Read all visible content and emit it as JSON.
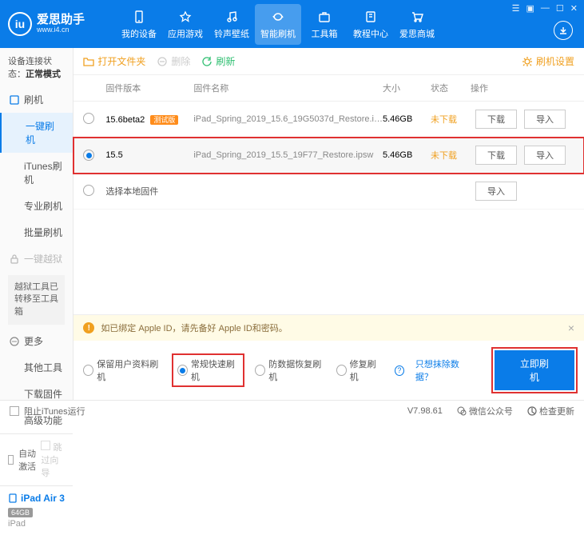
{
  "app": {
    "name_cn": "爱思助手",
    "name_en": "www.i4.cn"
  },
  "nav": [
    {
      "label": "我的设备"
    },
    {
      "label": "应用游戏"
    },
    {
      "label": "铃声壁纸"
    },
    {
      "label": "智能刷机",
      "active": true
    },
    {
      "label": "工具箱"
    },
    {
      "label": "教程中心"
    },
    {
      "label": "爱思商城"
    }
  ],
  "connection": {
    "prefix": "设备连接状态：",
    "value": "正常模式"
  },
  "sidebar": {
    "group_flash": "刷机",
    "items_flash": [
      {
        "label": "一键刷机",
        "active": true
      },
      {
        "label": "iTunes刷机"
      },
      {
        "label": "专业刷机"
      },
      {
        "label": "批量刷机"
      }
    ],
    "group_jb": "一键越狱",
    "jb_msg": "越狱工具已转移至工具箱",
    "group_more": "更多",
    "items_more": [
      {
        "label": "其他工具"
      },
      {
        "label": "下载固件"
      },
      {
        "label": "高级功能"
      }
    ],
    "auto_activate": "自动激活",
    "skip_guide": "跳过向导",
    "device": {
      "name": "iPad Air 3",
      "storage": "64GB",
      "type": "iPad"
    }
  },
  "toolbar": {
    "open_folder": "打开文件夹",
    "delete": "删除",
    "refresh": "刷新",
    "settings": "刷机设置"
  },
  "table": {
    "headers": {
      "version": "固件版本",
      "name": "固件名称",
      "size": "大小",
      "status": "状态",
      "ops": "操作"
    },
    "rows": [
      {
        "version": "15.6beta2",
        "beta": "测试版",
        "name": "iPad_Spring_2019_15.6_19G5037d_Restore.i…",
        "size": "5.46GB",
        "status": "未下载",
        "selected": false
      },
      {
        "version": "15.5",
        "name": "iPad_Spring_2019_15.5_19F77_Restore.ipsw",
        "size": "5.46GB",
        "status": "未下载",
        "selected": true
      }
    ],
    "local_fw": "选择本地固件",
    "btn_download": "下载",
    "btn_import": "导入"
  },
  "warning": "如已绑定 Apple ID，请先备好 Apple ID和密码。",
  "options": {
    "keep_data": "保留用户资料刷机",
    "normal_fast": "常规快速刷机",
    "anti_recovery": "防数据恢复刷机",
    "repair": "修复刷机",
    "exclude_link": "只想抹除数据？",
    "flash_now": "立即刷机"
  },
  "footer": {
    "block_itunes": "阻止iTunes运行",
    "version": "V7.98.61",
    "wechat": "微信公众号",
    "check_update": "检查更新"
  }
}
